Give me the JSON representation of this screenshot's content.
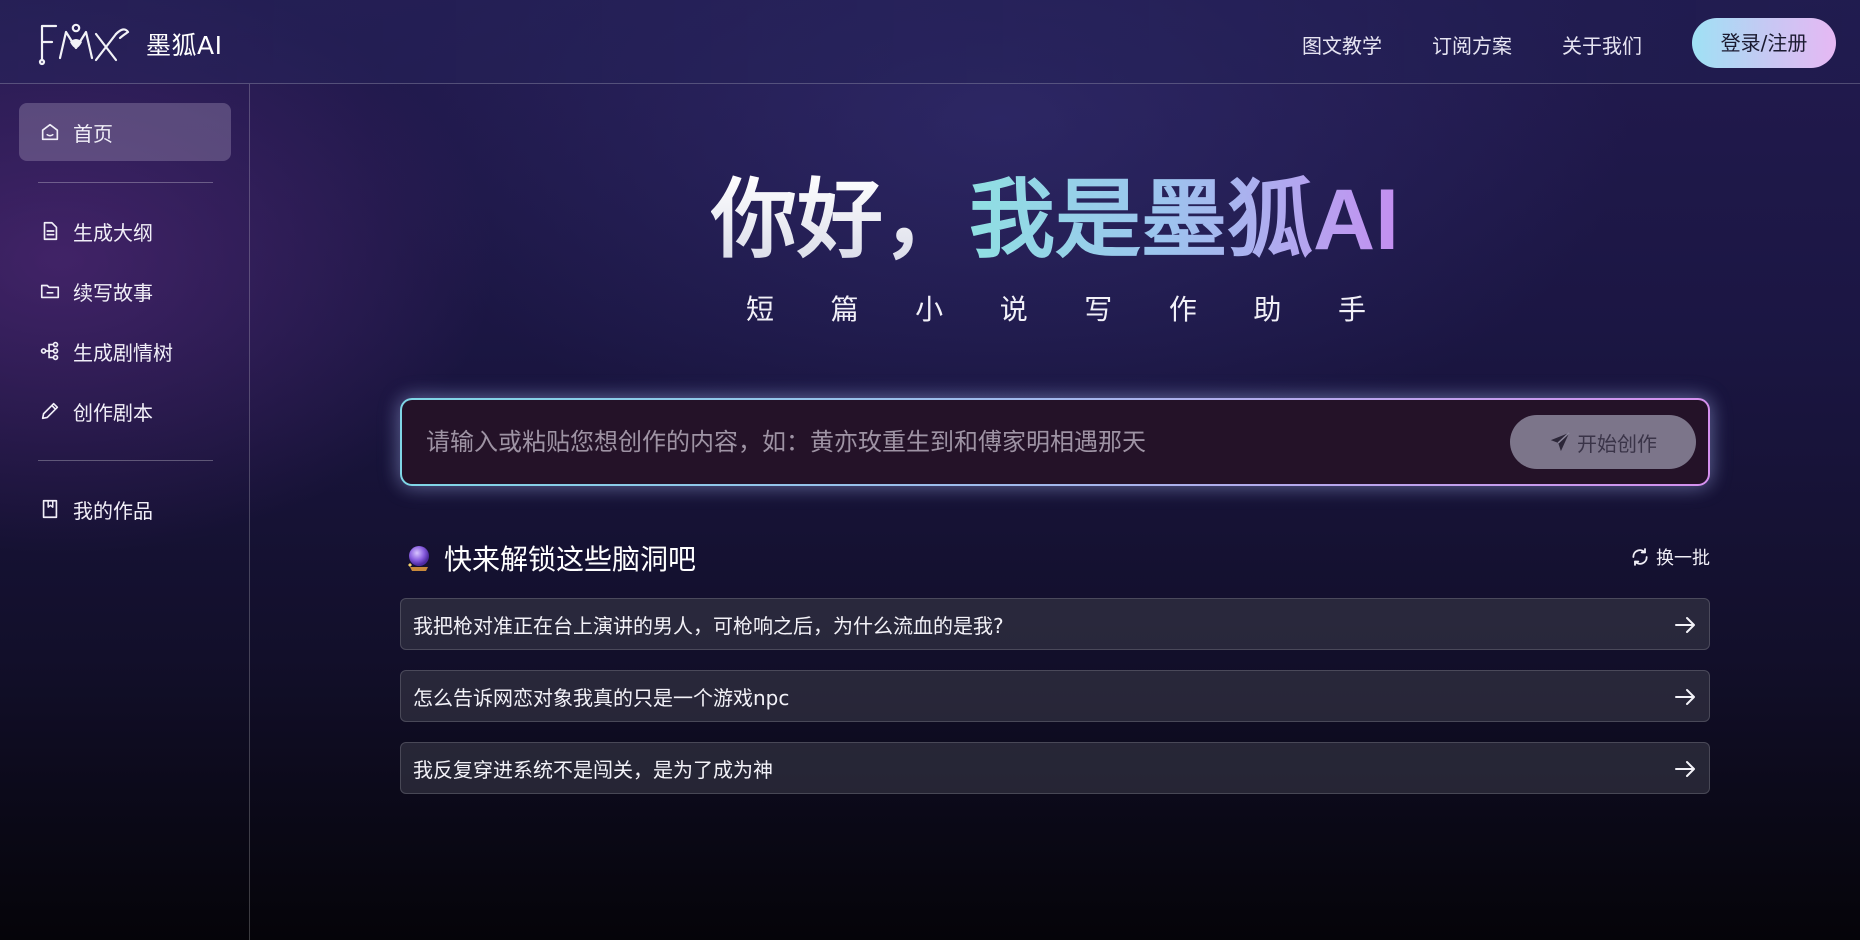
{
  "header": {
    "brand": "墨狐AI",
    "nav": [
      "图文教学",
      "订阅方案",
      "关于我们"
    ],
    "login_label": "登录/注册",
    "logo_icon": "fox-logo-icon"
  },
  "sidebar": {
    "items": [
      {
        "label": "首页",
        "icon": "home-icon",
        "active": true
      },
      {
        "label": "生成大纲",
        "icon": "document-icon"
      },
      {
        "label": "续写故事",
        "icon": "folder-icon"
      },
      {
        "label": "生成剧情树",
        "icon": "tree-icon"
      },
      {
        "label": "创作剧本",
        "icon": "pencil-icon"
      },
      {
        "label": "我的作品",
        "icon": "bookmark-icon"
      }
    ]
  },
  "hero": {
    "title_plain": "你好，",
    "title_gradient": "我是墨狐AI",
    "subtitle_chars": [
      "短",
      "篇",
      "小",
      "说",
      "写",
      "作",
      "助",
      "手"
    ]
  },
  "prompt": {
    "placeholder": "请输入或粘贴您想创作的内容，如：黄亦玫重生到和傅家明相遇那天",
    "submit_label": "开始创作",
    "submit_icon": "send-icon"
  },
  "suggestions": {
    "title": "快来解锁这些脑洞吧",
    "title_icon": "crystal-ball-icon",
    "refresh_label": "换一批",
    "refresh_icon": "refresh-icon",
    "items": [
      "我把枪对准正在台上演讲的男人，可枪响之后，为什么流血的是我?",
      "怎么告诉网恋对象我真的只是一个游戏npc",
      "我反复穿进系统不是闯关，是为了成为神"
    ]
  },
  "colors": {
    "accent_cyan": "#8fe0e2",
    "accent_purple": "#c48ff0",
    "active_item_bg": "#8b7fa8"
  }
}
